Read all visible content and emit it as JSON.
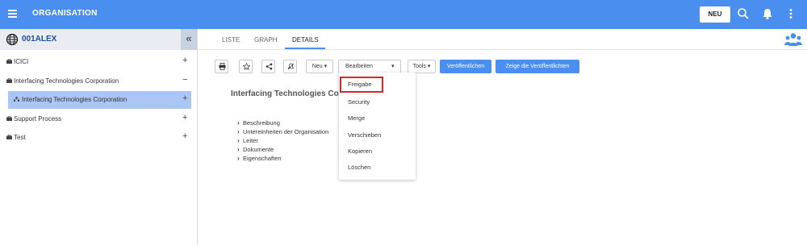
{
  "header": {
    "title": "ORGANISATION",
    "new_button": "NEU",
    "icons": [
      "menu-icon",
      "search-icon",
      "bell-icon",
      "more-vertical-icon"
    ]
  },
  "sidebar": {
    "title": "001ALEX",
    "collapse_glyph": "«",
    "items": [
      {
        "label": "ICICI",
        "toggle": "+",
        "selected": false
      },
      {
        "label": "Interfacing Technologies Corporation",
        "toggle": "−",
        "selected": false
      },
      {
        "label": "Interfacing Technologies Corporation",
        "toggle": "+",
        "selected": true
      },
      {
        "label": "Support Process",
        "toggle": "+",
        "selected": false
      },
      {
        "label": "Test",
        "toggle": "+",
        "selected": false
      }
    ]
  },
  "tabs": [
    {
      "label": "LISTE",
      "active": false
    },
    {
      "label": "GRAPH",
      "active": false
    },
    {
      "label": "DETAILS",
      "active": true
    }
  ],
  "toolbar": {
    "icon_buttons": [
      "print-icon",
      "star-icon",
      "share-icon",
      "no-notification-icon"
    ],
    "neu": "Neu ▾",
    "bearbeiten": "Bearbeiten",
    "bearbeiten_caret": "▾",
    "tools": "Tools ▾",
    "publish": "Veröffentlichen",
    "show_published": "Zeige die Veröffentlichten"
  },
  "main": {
    "org_title": "Interfacing Technologies Corp",
    "details": [
      "Beschreibung",
      "Untereinheiten der Organisation",
      "Leiter",
      "Dokumente",
      "Eigenschaften"
    ]
  },
  "dropdown": {
    "items": [
      "Freigabe",
      "Security",
      "Merge",
      "Verschieben",
      "Kopieren",
      "Löschen"
    ],
    "highlighted_index": 0
  },
  "colors": {
    "primary": "#4a8ff0",
    "selected_row": "#a9c6f4",
    "highlight_border": "#d9262c",
    "title_blue": "#1e4e9e"
  }
}
